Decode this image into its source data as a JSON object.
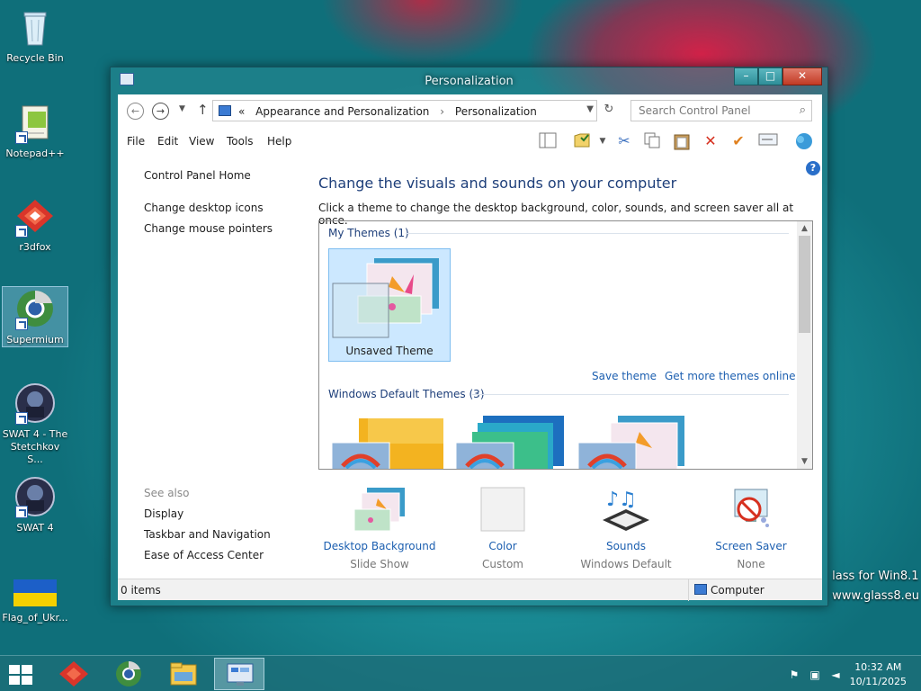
{
  "desktop": {
    "icons": [
      {
        "label": "Recycle Bin"
      },
      {
        "label": "Notepad++"
      },
      {
        "label": "r3dfox"
      },
      {
        "label": "Supermium"
      },
      {
        "label": "SWAT 4 - The Stetchkov S..."
      },
      {
        "label": "SWAT 4"
      },
      {
        "label": "Flag_of_Ukr..."
      }
    ],
    "watermark_line1": "lass for Win8.1",
    "watermark_line2": "www.glass8.eu"
  },
  "window": {
    "title": "Personalization",
    "controls": {
      "minimize": "–",
      "maximize": "□",
      "close": "✕"
    },
    "address": {
      "prefix": "«",
      "crumbs": [
        "Appearance and Personalization",
        "Personalization"
      ],
      "separator": "›"
    },
    "search_placeholder": "Search Control Panel",
    "menu": [
      "File",
      "Edit",
      "View",
      "Tools",
      "Help"
    ],
    "left_pane": {
      "home": "Control Panel Home",
      "links": [
        "Change desktop icons",
        "Change mouse pointers"
      ],
      "see_also_label": "See also",
      "see_also": [
        "Display",
        "Taskbar and Navigation",
        "Ease of Access Center"
      ]
    },
    "main": {
      "title": "Change the visuals and sounds on your computer",
      "subtitle": "Click a theme to change the desktop background, color, sounds, and screen saver all at once.",
      "my_themes_header": "My Themes (1)",
      "my_theme_name": "Unsaved Theme",
      "save_theme": "Save theme",
      "get_more": "Get more themes online",
      "default_themes_header": "Windows Default Themes (3)"
    },
    "options": [
      {
        "label": "Desktop Background",
        "value": "Slide Show"
      },
      {
        "label": "Color",
        "value": "Custom"
      },
      {
        "label": "Sounds",
        "value": "Windows Default"
      },
      {
        "label": "Screen Saver",
        "value": "None"
      }
    ],
    "status": {
      "items": "0 items",
      "location": "Computer"
    }
  },
  "taskbar": {
    "time": "10:32 AM",
    "date": "10/11/2025"
  },
  "colors": {
    "link": "#1c5fb0",
    "heading": "#1e3f7a",
    "selection": "#cce8ff"
  }
}
